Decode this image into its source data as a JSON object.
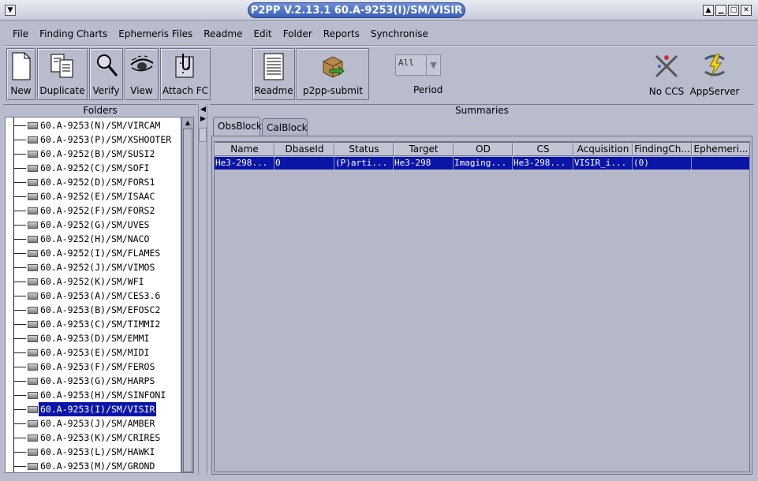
{
  "window": {
    "title": "P2PP V.2.13.1 60.A-9253(I)/SM/VISIR"
  },
  "menu": [
    "File",
    "Finding Charts",
    "Ephemeris Files",
    "Readme",
    "Edit",
    "Folder",
    "Reports",
    "Synchronise"
  ],
  "toolbar": {
    "new": "New",
    "duplicate": "Duplicate",
    "verify": "Verify",
    "view": "View",
    "attach_fc": "Attach FC",
    "readme": "Readme",
    "submit": "p2pp-submit",
    "period_value": "All",
    "period_label": "Period",
    "no_ccs": "No CCS",
    "appserver": "AppServer"
  },
  "folders": {
    "title": "Folders",
    "items": [
      "60.A-9253(N)/SM/VIRCAM",
      "60.A-9253(P)/SM/XSHOOTER",
      "60.A-9252(B)/SM/SUSI2",
      "60.A-9252(C)/SM/SOFI",
      "60.A-9252(D)/SM/FORS1",
      "60.A-9252(E)/SM/ISAAC",
      "60.A-9252(F)/SM/FORS2",
      "60.A-9252(G)/SM/UVES",
      "60.A-9252(H)/SM/NACO",
      "60.A-9252(I)/SM/FLAMES",
      "60.A-9252(J)/SM/VIMOS",
      "60.A-9252(K)/SM/WFI",
      "60.A-9253(A)/SM/CES3.6",
      "60.A-9253(B)/SM/EFOSC2",
      "60.A-9253(C)/SM/TIMMI2",
      "60.A-9253(D)/SM/EMMI",
      "60.A-9253(E)/SM/MIDI",
      "60.A-9253(F)/SM/FEROS",
      "60.A-9253(G)/SM/HARPS",
      "60.A-9253(H)/SM/SINFONI",
      "60.A-9253(I)/SM/VISIR",
      "60.A-9253(J)/SM/AMBER",
      "60.A-9253(K)/SM/CRIRES",
      "60.A-9253(L)/SM/HAWKI",
      "60.A-9253(M)/SM/GROND"
    ],
    "selected_index": 20
  },
  "summaries": {
    "title": "Summaries",
    "tabs": [
      "ObsBlock",
      "CalBlock"
    ],
    "active_tab": 0,
    "columns": [
      "Name",
      "DbaseId",
      "Status",
      "Target",
      "OD",
      "CS",
      "Acquisition",
      "FindingCh...",
      "Ephemeri..."
    ],
    "rows": [
      [
        "He3-298...",
        "0",
        "(P)arti...",
        "He3-298",
        "Imaging...",
        "He3-298...",
        "VISIR_i...",
        "(0)",
        ""
      ]
    ]
  }
}
